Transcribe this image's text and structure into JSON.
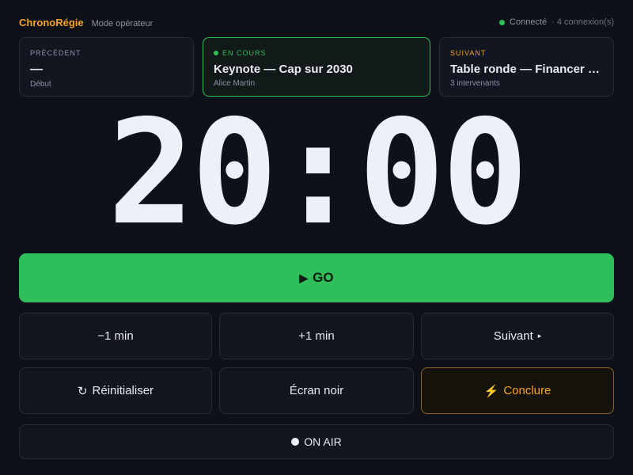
{
  "header": {
    "brand": "ChronoRégie",
    "mode": "Mode opérateur",
    "connection_status": "Connecté",
    "connection_count": "· 4 connexion(s)",
    "status_color": "#2fbf5a"
  },
  "cards": {
    "previous": {
      "kicker": "PRÉCÉDENT",
      "title": "—",
      "subtitle": "Début"
    },
    "current": {
      "kicker": "EN COURS",
      "title": "Keynote — Cap sur 2030",
      "subtitle": "Alice Martin"
    },
    "next": {
      "kicker": "SUIVANT",
      "title": "Table ronde — Financer la r...",
      "subtitle": "3 intervenants"
    }
  },
  "timer": {
    "display": "20:00"
  },
  "controls": {
    "go_icon": "▶",
    "go_label": "GO",
    "minus_label": "−1 min",
    "plus_label": "+1 min",
    "next_label": "Suivant",
    "next_icon": "▸",
    "reset_icon": "↻",
    "reset_label": "Réinitialiser",
    "black_label": "Écran noir",
    "conclude_icon": "⚡",
    "conclude_label": "Conclure",
    "onair_label": "ON AIR"
  },
  "colors": {
    "accent": "#f5a524",
    "go": "#2fbf5a",
    "background": "#0e1117"
  }
}
